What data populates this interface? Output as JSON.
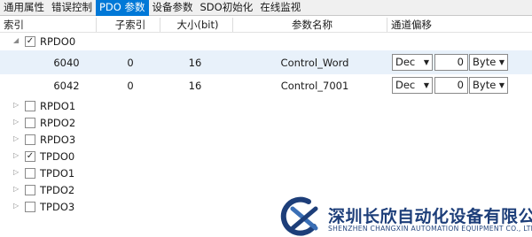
{
  "tabs": [
    {
      "label": "通用属性",
      "active": false
    },
    {
      "label": "错误控制",
      "active": false
    },
    {
      "label": "PDO 参数",
      "active": true
    },
    {
      "label": "设备参数",
      "active": false
    },
    {
      "label": "SDO初始化",
      "active": false
    },
    {
      "label": "在线监视",
      "active": false
    }
  ],
  "columns": {
    "index": "索引",
    "subindex": "子索引",
    "size": "大小(bit)",
    "name": "参数名称",
    "offset": "通道偏移"
  },
  "tree": {
    "rpdo0": {
      "label": "RPDO0",
      "checked": true,
      "expanded": true,
      "entries": [
        {
          "index": "6040",
          "subindex": "0",
          "size": "16",
          "name": "Control_Word",
          "format": "Dec",
          "offset": "0",
          "unit": "Byte",
          "selected": true
        },
        {
          "index": "6042",
          "subindex": "0",
          "size": "16",
          "name": "Control_7001",
          "format": "Dec",
          "offset": "0",
          "unit": "Byte",
          "selected": false
        }
      ]
    },
    "others": [
      {
        "label": "RPDO1",
        "checked": false
      },
      {
        "label": "RPDO2",
        "checked": false
      },
      {
        "label": "RPDO3",
        "checked": false
      },
      {
        "label": "TPDO0",
        "checked": true
      },
      {
        "label": "TPDO1",
        "checked": false
      },
      {
        "label": "TPDO2",
        "checked": false
      },
      {
        "label": "TPDO3",
        "checked": false
      }
    ]
  },
  "icons": {
    "expanded": "triangle-down-icon",
    "collapsed": "triangle-right-icon",
    "check": "check-icon",
    "dropdown": "chevron-down-icon",
    "logo": "cx-logo-icon"
  },
  "watermark": {
    "company_cn": "深圳长欣自动化设备有限公司",
    "company_en": "SHENZHEN CHANGXIN AUTOMATION EQUIPMENT CO., LTD."
  },
  "colors": {
    "active_tab": "#0078d7",
    "selected_row": "#e8f1fa",
    "logo_blue": "#1d3e79"
  }
}
